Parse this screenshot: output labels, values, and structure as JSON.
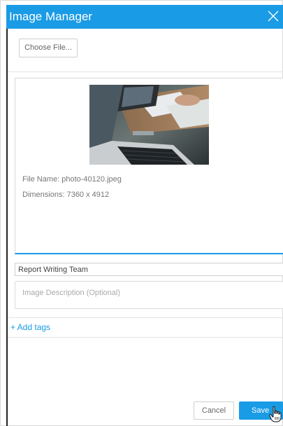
{
  "dialog": {
    "title": "Image Manager",
    "close_icon": "close-icon"
  },
  "upload": {
    "choose_label": "Choose File..."
  },
  "image": {
    "thumbnail_icon": "laptop-desk-photo",
    "file_name_text": "File Name: photo-40120.jpeg",
    "dimensions_text": "Dimensions: 7360 x 4912"
  },
  "form": {
    "title_value": "Report Writing Team",
    "description_placeholder": "Image Description (Optional)",
    "add_tags_label": "+ Add tags"
  },
  "footer": {
    "cancel_label": "Cancel",
    "save_label": "Save",
    "cursor_icon": "hand-pointer-icon"
  },
  "colors": {
    "accent": "#1a9be6",
    "border": "#d6d6d6"
  }
}
